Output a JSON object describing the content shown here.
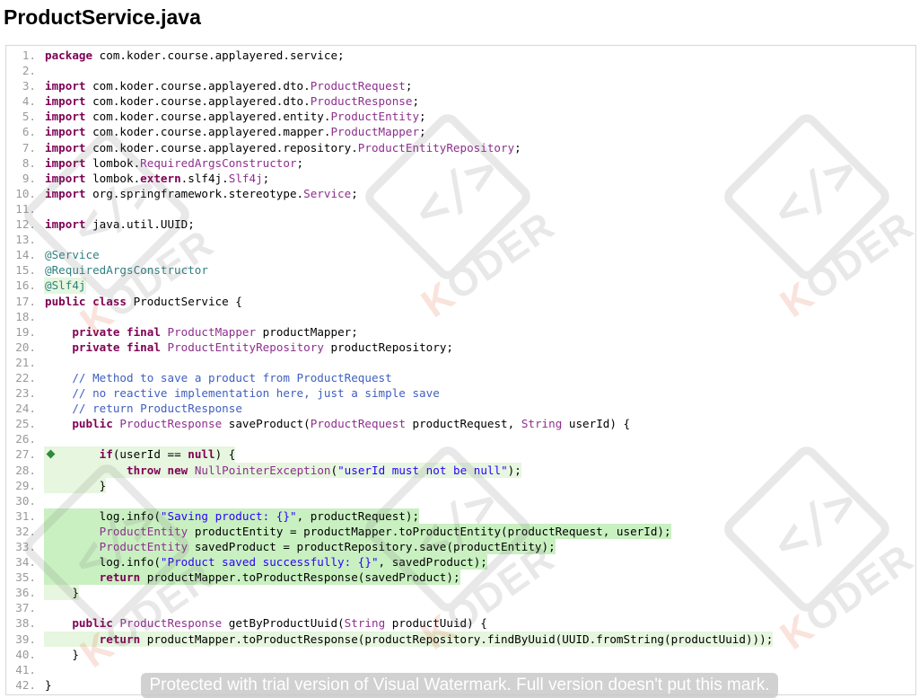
{
  "file": {
    "title": "ProductService.java"
  },
  "code": {
    "lines": [
      {
        "n": "1.",
        "hl": "",
        "t": [
          [
            "kw",
            "package"
          ],
          [
            "",
            "com.koder.course.applayered.service;"
          ]
        ]
      },
      {
        "n": "2.",
        "hl": "",
        "t": []
      },
      {
        "n": "3.",
        "hl": "",
        "t": [
          [
            "kw",
            "import"
          ],
          [
            "",
            "com.koder.course.applayered.dto."
          ],
          [
            "ty",
            "ProductRequest"
          ],
          [
            "",
            ";"
          ]
        ]
      },
      {
        "n": "4.",
        "hl": "",
        "t": [
          [
            "kw",
            "import"
          ],
          [
            "",
            "com.koder.course.applayered.dto."
          ],
          [
            "ty",
            "ProductResponse"
          ],
          [
            "",
            ";"
          ]
        ]
      },
      {
        "n": "5.",
        "hl": "",
        "t": [
          [
            "kw",
            "import"
          ],
          [
            "",
            "com.koder.course.applayered.entity."
          ],
          [
            "ty",
            "ProductEntity"
          ],
          [
            "",
            ";"
          ]
        ]
      },
      {
        "n": "6.",
        "hl": "",
        "t": [
          [
            "kw",
            "import"
          ],
          [
            "",
            "com.koder.course.applayered.mapper."
          ],
          [
            "ty",
            "ProductMapper"
          ],
          [
            "",
            ";"
          ]
        ]
      },
      {
        "n": "7.",
        "hl": "",
        "t": [
          [
            "kw",
            "import"
          ],
          [
            "",
            "com.koder.course.applayered.repository."
          ],
          [
            "ty",
            "ProductEntityRepository"
          ],
          [
            "",
            ";"
          ]
        ]
      },
      {
        "n": "8.",
        "hl": "",
        "t": [
          [
            "kw",
            "import"
          ],
          [
            "",
            "lombok."
          ],
          [
            "ty",
            "RequiredArgsConstructor"
          ],
          [
            "",
            ";"
          ]
        ]
      },
      {
        "n": "9.",
        "hl": "",
        "t": [
          [
            "kw",
            "import"
          ],
          [
            "",
            "lombok."
          ],
          [
            "kw",
            "extern"
          ],
          [
            "",
            ".slf4j."
          ],
          [
            "ty",
            "Slf4j"
          ],
          [
            "",
            ";"
          ]
        ]
      },
      {
        "n": "10.",
        "hl": "",
        "t": [
          [
            "kw",
            "import"
          ],
          [
            "",
            "org.springframework.stereotype."
          ],
          [
            "ty",
            "Service"
          ],
          [
            "",
            ";"
          ]
        ]
      },
      {
        "n": "11.",
        "hl": "",
        "t": []
      },
      {
        "n": "12.",
        "hl": "",
        "t": [
          [
            "kw",
            "import"
          ],
          [
            "",
            "java.util.UUID;"
          ]
        ]
      },
      {
        "n": "13.",
        "hl": "",
        "t": []
      },
      {
        "n": "14.",
        "hl": "",
        "t": [
          [
            "an2",
            "@Service"
          ]
        ]
      },
      {
        "n": "15.",
        "hl": "",
        "t": [
          [
            "an2",
            "@RequiredArgsConstructor"
          ]
        ]
      },
      {
        "n": "16.",
        "hl": "partial",
        "t": [
          [
            "an2",
            "@Slf4j"
          ]
        ]
      },
      {
        "n": "17.",
        "hl": "",
        "t": [
          [
            "kw",
            "public"
          ],
          [
            "",
            ""
          ],
          [
            "kw",
            "class"
          ],
          [
            "",
            "ProductService {"
          ]
        ]
      },
      {
        "n": "18.",
        "hl": "",
        "t": []
      },
      {
        "n": "19.",
        "hl": "",
        "t": [
          [
            "",
            "    "
          ],
          [
            "kw",
            "private"
          ],
          [
            "",
            ""
          ],
          [
            "kw",
            "final"
          ],
          [
            "",
            ""
          ],
          [
            "ty",
            "ProductMapper"
          ],
          [
            "",
            "productMapper;"
          ]
        ]
      },
      {
        "n": "20.",
        "hl": "",
        "t": [
          [
            "",
            "    "
          ],
          [
            "kw",
            "private"
          ],
          [
            "",
            ""
          ],
          [
            "kw",
            "final"
          ],
          [
            "",
            ""
          ],
          [
            "ty",
            "ProductEntityRepository"
          ],
          [
            "",
            "productRepository;"
          ]
        ]
      },
      {
        "n": "21.",
        "hl": "",
        "t": []
      },
      {
        "n": "22.",
        "hl": "",
        "t": [
          [
            "",
            "    "
          ],
          [
            "cm",
            "// Method to save a product from ProductRequest"
          ]
        ]
      },
      {
        "n": "23.",
        "hl": "",
        "t": [
          [
            "",
            "    "
          ],
          [
            "cm",
            "// no reactive implementation here, just a simple save"
          ]
        ]
      },
      {
        "n": "24.",
        "hl": "",
        "t": [
          [
            "",
            "    "
          ],
          [
            "cm",
            "// return ProductResponse"
          ]
        ]
      },
      {
        "n": "25.",
        "hl": "",
        "t": [
          [
            "",
            "    "
          ],
          [
            "kw",
            "public"
          ],
          [
            "",
            ""
          ],
          [
            "ty",
            "ProductResponse"
          ],
          [
            "",
            "saveProduct("
          ],
          [
            "ty",
            "ProductRequest"
          ],
          [
            "",
            "productRequest, "
          ],
          [
            "ty",
            "String"
          ],
          [
            "",
            "userId) {"
          ]
        ]
      },
      {
        "n": "26.",
        "hl": "",
        "t": []
      },
      {
        "n": "27.",
        "hl": "partial",
        "bp": true,
        "t": [
          [
            "",
            "        "
          ],
          [
            "kw",
            "if"
          ],
          [
            "",
            "(userId == "
          ],
          [
            "kw",
            "null"
          ],
          [
            "",
            ") {"
          ]
        ]
      },
      {
        "n": "28.",
        "hl": "partial",
        "t": [
          [
            "",
            "            "
          ],
          [
            "kw",
            "throw"
          ],
          [
            "",
            ""
          ],
          [
            "kw",
            "new"
          ],
          [
            "",
            ""
          ],
          [
            "ty",
            "NullPointerException"
          ],
          [
            "",
            "("
          ],
          [
            "st",
            "\"userId must not be null\""
          ],
          [
            "",
            ");"
          ]
        ]
      },
      {
        "n": "29.",
        "hl": "partial",
        "t": [
          [
            "",
            "        }"
          ]
        ]
      },
      {
        "n": "30.",
        "hl": "",
        "t": []
      },
      {
        "n": "31.",
        "hl": "full",
        "t": [
          [
            "",
            "        log.info("
          ],
          [
            "st",
            "\"Saving product: {}\""
          ],
          [
            "",
            ", productRequest);"
          ]
        ]
      },
      {
        "n": "32.",
        "hl": "full",
        "t": [
          [
            "",
            "        "
          ],
          [
            "ty",
            "ProductEntity"
          ],
          [
            "",
            "productEntity = productMapper.toProductEntity(productRequest, userId);"
          ]
        ]
      },
      {
        "n": "33.",
        "hl": "full",
        "t": [
          [
            "",
            "        "
          ],
          [
            "ty",
            "ProductEntity"
          ],
          [
            "",
            "savedProduct = productRepository.save(productEntity);"
          ]
        ]
      },
      {
        "n": "34.",
        "hl": "full",
        "t": [
          [
            "",
            "        log.info("
          ],
          [
            "st",
            "\"Product saved successfully: {}\""
          ],
          [
            "",
            ", savedProduct);"
          ]
        ]
      },
      {
        "n": "35.",
        "hl": "full",
        "t": [
          [
            "",
            "        "
          ],
          [
            "kw",
            "return"
          ],
          [
            "",
            "productMapper.toProductResponse(savedProduct);"
          ]
        ]
      },
      {
        "n": "36.",
        "hl": "partial",
        "t": [
          [
            "",
            "    }"
          ]
        ]
      },
      {
        "n": "37.",
        "hl": "",
        "t": []
      },
      {
        "n": "38.",
        "hl": "",
        "t": [
          [
            "",
            "    "
          ],
          [
            "kw",
            "public"
          ],
          [
            "",
            ""
          ],
          [
            "ty",
            "ProductResponse"
          ],
          [
            "",
            "getByProductUuid("
          ],
          [
            "ty",
            "String"
          ],
          [
            "",
            "productUuid) {"
          ]
        ]
      },
      {
        "n": "39.",
        "hl": "partial",
        "t": [
          [
            "",
            "        "
          ],
          [
            "kw",
            "return"
          ],
          [
            "",
            "productMapper.toProductResponse(productRepository.findByUuid(UUID.fromString(productUuid)));"
          ]
        ]
      },
      {
        "n": "40.",
        "hl": "",
        "t": [
          [
            "",
            "    }"
          ]
        ]
      },
      {
        "n": "41.",
        "hl": "",
        "t": []
      },
      {
        "n": "42.",
        "hl": "",
        "t": [
          [
            "",
            "}"
          ]
        ]
      }
    ]
  },
  "watermark": {
    "logo_text": "KODER",
    "logo_glyph": "</>",
    "trial_notice": "Protected with trial version of Visual Watermark. Full version doesn't put this mark."
  },
  "colors": {
    "keyword": "#7f0055",
    "type": "#8e2f8e",
    "string": "#2a00ff",
    "comment": "#3f5fbf",
    "highlight_strong": "#c9f0c1",
    "highlight_light": "#e6f6df"
  }
}
